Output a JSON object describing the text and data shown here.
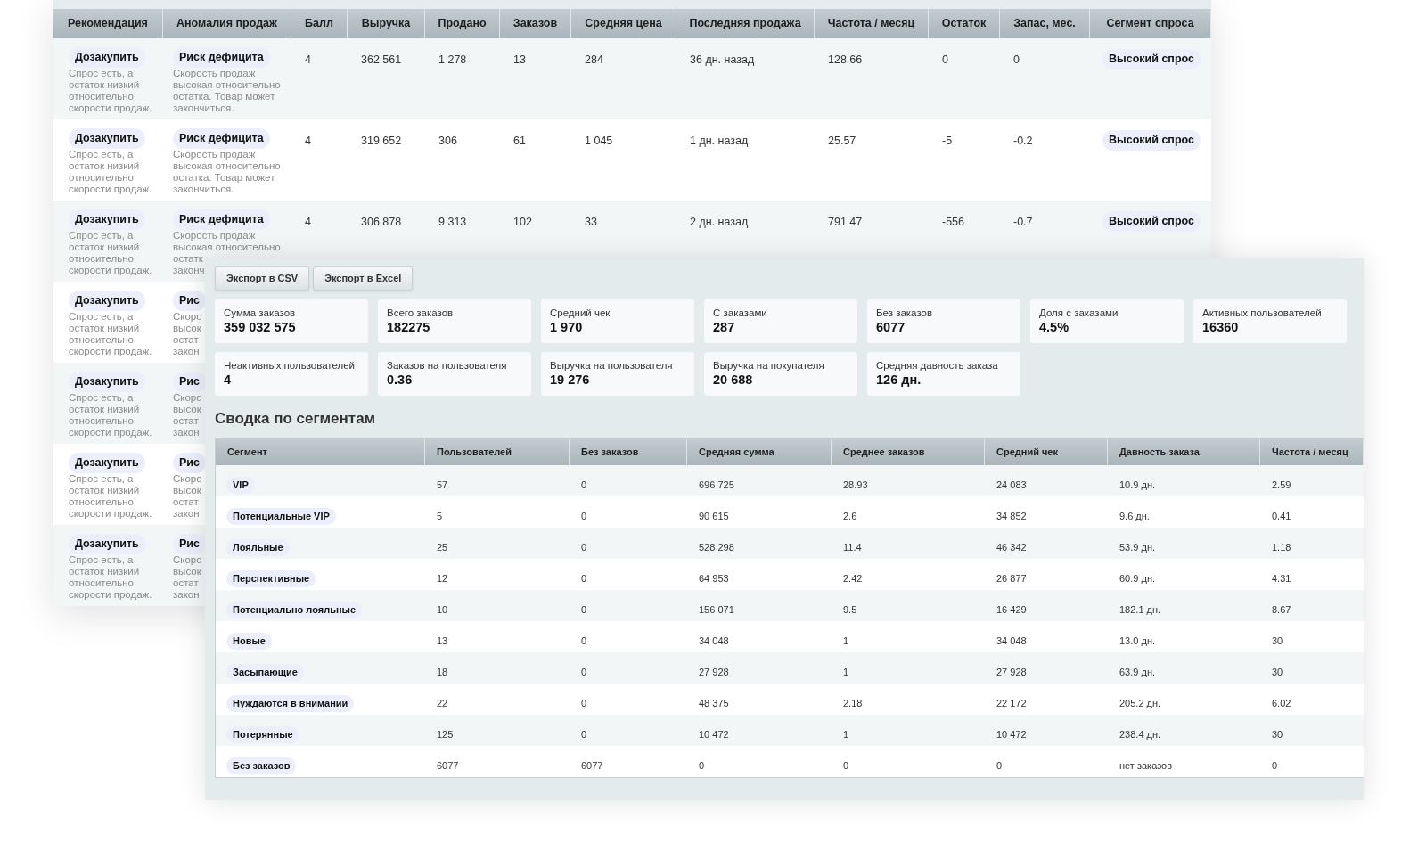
{
  "product_table": {
    "columns": [
      "Рекомендация",
      "Аномалия продаж",
      "Балл",
      "Выручка",
      "Продано",
      "Заказов",
      "Средняя цена",
      "Последняя продажа",
      "Частота / месяц",
      "Остаток",
      "Запас, мес.",
      "Сегмент спроса"
    ],
    "rows": [
      {
        "recommendation": "Дозакупить",
        "recommendation_note": [
          "Спрос есть, а",
          "остаток низкий",
          "относительно",
          "скорости продаж."
        ],
        "anomaly": "Риск дефицита",
        "anomaly_note": [
          "Скорость продаж",
          "высокая относительно",
          "остатка. Товар может",
          "закончиться."
        ],
        "values": [
          "4",
          "362 561",
          "1 278",
          "13",
          "284",
          "36 дн. назад",
          "128.66",
          "0",
          "0"
        ],
        "segment": "Высокий спрос"
      },
      {
        "recommendation": "Дозакупить",
        "recommendation_note": [
          "Спрос есть, а",
          "остаток низкий",
          "относительно",
          "скорости продаж."
        ],
        "anomaly": "Риск дефицита",
        "anomaly_note": [
          "Скорость продаж",
          "высокая относительно",
          "остатка. Товар может",
          "закончиться."
        ],
        "values": [
          "4",
          "319 652",
          "306",
          "61",
          "1 045",
          "1 дн. назад",
          "25.57",
          "-5",
          "-0.2"
        ],
        "segment": "Высокий спрос"
      },
      {
        "recommendation": "Дозакупить",
        "recommendation_note": [
          "Спрос есть, а",
          "остаток низкий",
          "относительно",
          "скорости продаж."
        ],
        "anomaly": "Риск дефицита",
        "anomaly_note": [
          "Скорость продаж",
          "высокая относительно",
          "остатк",
          "законч"
        ],
        "values": [
          "4",
          "306 878",
          "9 313",
          "102",
          "33",
          "2 дн. назад",
          "791.47",
          "-556",
          "-0.7"
        ],
        "segment": "Высокий спрос"
      },
      {
        "recommendation": "Дозакупить",
        "recommendation_note": [
          "Спрос есть, а",
          "остаток низкий",
          "относительно",
          "скорости продаж."
        ],
        "anomaly": "Рис",
        "anomaly_note": [
          "Скоро",
          "высок",
          "остат",
          "закон"
        ]
      },
      {
        "recommendation": "Дозакупить",
        "recommendation_note": [
          "Спрос есть, а",
          "остаток низкий",
          "относительно",
          "скорости продаж."
        ],
        "anomaly": "Рис",
        "anomaly_note": [
          "Скоро",
          "высок",
          "остат",
          "закон"
        ]
      },
      {
        "recommendation": "Дозакупить",
        "recommendation_note": [
          "Спрос есть, а",
          "остаток низкий",
          "относительно",
          "скорости продаж."
        ],
        "anomaly": "Рис",
        "anomaly_note": [
          "Скоро",
          "высок",
          "остат",
          "закон"
        ]
      },
      {
        "recommendation": "Дозакупить",
        "recommendation_note": [
          "Спрос есть, а",
          "остаток низкий",
          "относительно",
          "скорости продаж."
        ],
        "anomaly": "Рис",
        "anomaly_note": [
          "Скоро",
          "высок",
          "остат",
          "закон"
        ]
      }
    ]
  },
  "export_buttons": [
    "Экспорт в CSV",
    "Экспорт в Excel"
  ],
  "stats": [
    {
      "label": "Сумма заказов",
      "value": "359 032 575"
    },
    {
      "label": "Всего заказов",
      "value": "182275"
    },
    {
      "label": "Средний чек",
      "value": "1 970"
    },
    {
      "label": "С заказами",
      "value": "287"
    },
    {
      "label": "Без заказов",
      "value": "6077"
    },
    {
      "label": "Доля с заказами",
      "value": "4.5%"
    },
    {
      "label": "Активных пользователей",
      "value": "16360"
    },
    {
      "label": "Неактивных пользователей",
      "value": "4"
    },
    {
      "label": "Заказов на пользователя",
      "value": "0.36"
    },
    {
      "label": "Выручка на пользователя",
      "value": "19 276"
    },
    {
      "label": "Выручка на покупателя",
      "value": "20 688"
    },
    {
      "label": "Средняя давность заказа",
      "value": "126 дн."
    }
  ],
  "segments": {
    "title": "Сводка по сегментам",
    "columns": [
      "Сегмент",
      "Пользователей",
      "Без заказов",
      "Средняя сумма",
      "Среднее заказов",
      "Средний чек",
      "Давность заказа",
      "Частота / месяц"
    ],
    "rows": [
      [
        "VIP",
        "57",
        "0",
        "696 725",
        "28.93",
        "24 083",
        "10.9 дн.",
        "2.59"
      ],
      [
        "Потенциальные VIP",
        "5",
        "0",
        "90 615",
        "2.6",
        "34 852",
        "9.6 дн.",
        "0.41"
      ],
      [
        "Лояльные",
        "25",
        "0",
        "528 298",
        "11.4",
        "46 342",
        "53.9 дн.",
        "1.18"
      ],
      [
        "Перспективные",
        "12",
        "0",
        "64 953",
        "2.42",
        "26 877",
        "60.9 дн.",
        "4.31"
      ],
      [
        "Потенциально лояльные",
        "10",
        "0",
        "156 071",
        "9.5",
        "16 429",
        "182.1 дн.",
        "8.67"
      ],
      [
        "Новые",
        "13",
        "0",
        "34 048",
        "1",
        "34 048",
        "13.0 дн.",
        "30"
      ],
      [
        "Засыпающие",
        "18",
        "0",
        "27 928",
        "1",
        "27 928",
        "63.9 дн.",
        "30"
      ],
      [
        "Нуждаются в внимании",
        "22",
        "0",
        "48 375",
        "2.18",
        "22 172",
        "205.2 дн.",
        "6.02"
      ],
      [
        "Потерянные",
        "125",
        "0",
        "10 472",
        "1",
        "10 472",
        "238.4 дн.",
        "30"
      ],
      [
        "Без заказов",
        "6077",
        "6077",
        "0",
        "0",
        "0",
        "нет заказов",
        "0"
      ]
    ]
  }
}
